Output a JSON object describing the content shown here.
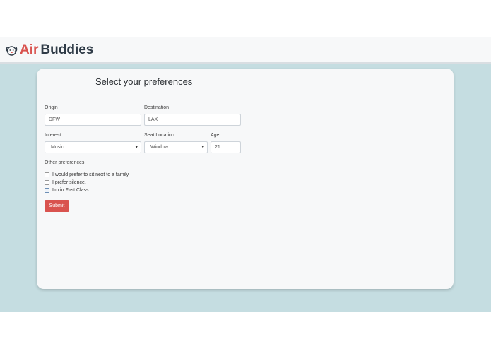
{
  "brand": {
    "part1": "Air",
    "part2": "Buddies"
  },
  "colors": {
    "accent": "#d9534f",
    "page_bg": "#c5dde1",
    "brand_dark": "#2f3b47"
  },
  "icons": {
    "logo": "dog-face-icon",
    "select_caret": "caret-down-icon"
  },
  "form": {
    "title": "Select your preferences",
    "origin": {
      "label": "Origin",
      "value": "DFW"
    },
    "destination": {
      "label": "Destination",
      "value": "LAX"
    },
    "interest": {
      "label": "Interest",
      "value": "Music"
    },
    "seat_location": {
      "label": "Seat Location",
      "value": "Window"
    },
    "age": {
      "label": "Age",
      "value": "21"
    },
    "other_label": "Other preferences:",
    "options": [
      {
        "label": "I would prefer to sit next to a family.",
        "checked": false
      },
      {
        "label": "I prefer silence.",
        "checked": false
      },
      {
        "label": "I'm in First Class.",
        "checked": false
      }
    ],
    "submit_label": "Submit"
  }
}
